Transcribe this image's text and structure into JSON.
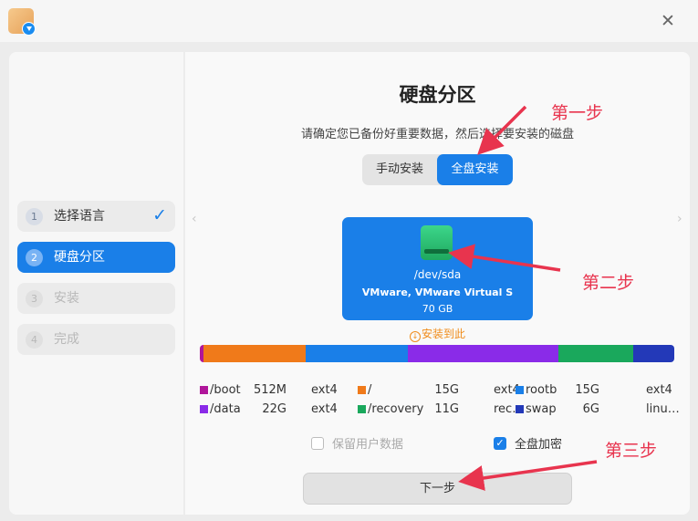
{
  "window": {
    "app_icon": "installer-package-icon",
    "close_icon": "close-icon"
  },
  "sidebar": {
    "steps": [
      {
        "num": "1",
        "label": "选择语言",
        "state": "done"
      },
      {
        "num": "2",
        "label": "硬盘分区",
        "state": "active"
      },
      {
        "num": "3",
        "label": "安装",
        "state": "disabled"
      },
      {
        "num": "4",
        "label": "完成",
        "state": "disabled"
      }
    ],
    "check_glyph": "✓"
  },
  "main": {
    "title": "硬盘分区",
    "subtitle": "请确定您已备份好重要数据，然后选择要安装的磁盘",
    "mode_tabs": [
      {
        "label": "手动安装",
        "selected": false
      },
      {
        "label": "全盘安装",
        "selected": true
      }
    ],
    "disk": {
      "name": "/dev/sda",
      "model": "VMware, VMware Virtual S",
      "size": "70 GB",
      "icon": "hard-disk-icon"
    },
    "install_here": "安装到此",
    "partitions": [
      {
        "name": "/boot",
        "size": "512M",
        "fs": "ext4",
        "color": "#b0169a",
        "size_gb": 0.5
      },
      {
        "name": "/",
        "size": "15G",
        "fs": "ext4",
        "color": "#f07a1a",
        "size_gb": 15
      },
      {
        "name": "rootb",
        "size": "15G",
        "fs": "ext4",
        "color": "#1a7fe8",
        "size_gb": 15
      },
      {
        "name": "/data",
        "size": "22G",
        "fs": "ext4",
        "color": "#8a2be8",
        "size_gb": 22
      },
      {
        "name": "/recovery",
        "size": "11G",
        "fs": "rec…",
        "color": "#1aa85c",
        "size_gb": 11
      },
      {
        "name": "swap",
        "size": "6G",
        "fs": "linu…",
        "color": "#2339b8",
        "size_gb": 6
      }
    ],
    "options": {
      "keep_user_data": {
        "label": "保留用户数据",
        "checked": false
      },
      "full_disk_encryption": {
        "label": "全盘加密",
        "checked": true
      }
    },
    "next_button": "下一步"
  },
  "annotations": {
    "step1": "第一步",
    "step2": "第二步",
    "step3": "第三步",
    "color": "#e8344e"
  }
}
